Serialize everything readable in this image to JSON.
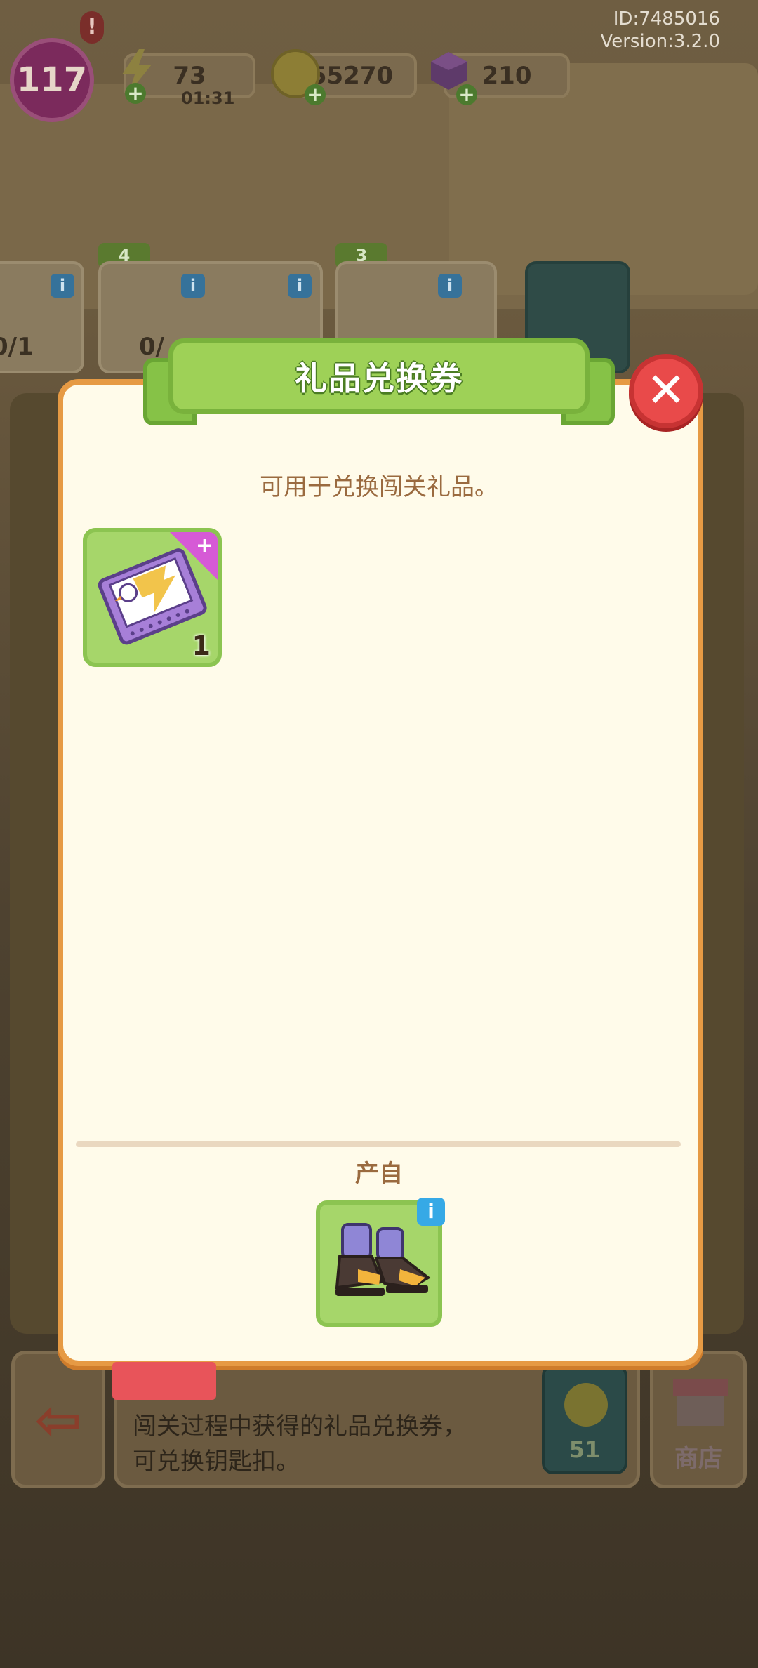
{
  "hud": {
    "level": "117",
    "alert": "!",
    "energy": "73",
    "energy_timer": "01:31",
    "coins": "55270",
    "gems": "210",
    "user_id": "ID:7485016",
    "version": "Version:3.2.0"
  },
  "orders": [
    {
      "count": "0/1",
      "star": ""
    },
    {
      "count": "0/",
      "star": "4"
    },
    {
      "count": "",
      "star": "3"
    }
  ],
  "bottom": {
    "description_lines": [
      "闯关过程中获得的礼品兑换券，",
      "可兑换钥匙扣。"
    ],
    "coin_value": "51",
    "shop_label": "商店"
  },
  "dialog": {
    "title": "礼品兑换券",
    "description": "可用于兑换闯关礼品。",
    "item_count": "1",
    "source_label": "产自",
    "info_symbol": "i",
    "close_symbol": "✕",
    "plus_symbol": "+"
  },
  "colors": {
    "dialog_border": "#e69a44",
    "title_green": "#9ed157",
    "close_red": "#e94a4a",
    "tile_green": "#a6d66a",
    "text_brown": "#9a6a3f"
  }
}
